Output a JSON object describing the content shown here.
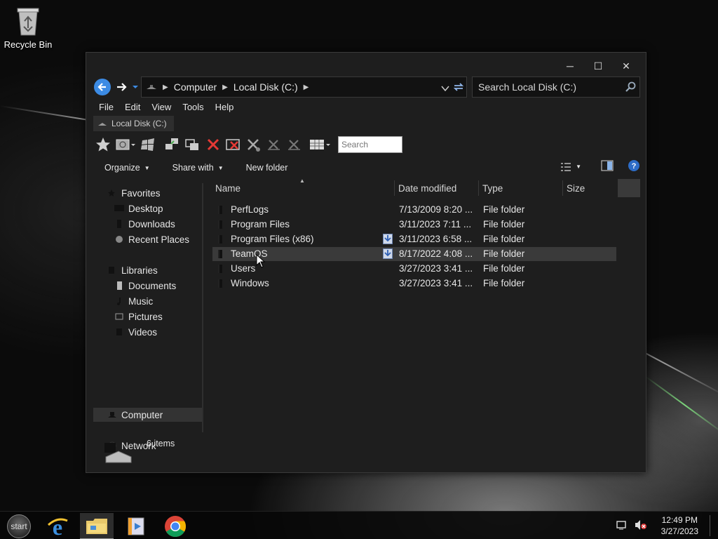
{
  "desktop": {
    "icons": [
      {
        "label": "Recycle Bin",
        "icon": "recycle-bin-icon"
      }
    ]
  },
  "window": {
    "controls": {
      "minimize": "─",
      "maximize": "☐",
      "close": "✕"
    },
    "address": {
      "segments": [
        "Computer",
        "Local Disk (C:)"
      ],
      "search_placeholder": "Search Local Disk (C:)"
    },
    "menu": [
      "File",
      "Edit",
      "View",
      "Tools",
      "Help"
    ],
    "tab_label": "Local Disk (C:)",
    "toolbar_search_placeholder": "Search",
    "commands": {
      "organize": "Organize",
      "share_with": "Share with",
      "new_folder": "New folder"
    },
    "nav_pane": {
      "favorites": {
        "label": "Favorites",
        "items": [
          "Desktop",
          "Downloads",
          "Recent Places"
        ]
      },
      "libraries": {
        "label": "Libraries",
        "items": [
          "Documents",
          "Music",
          "Pictures",
          "Videos"
        ]
      },
      "computer": "Computer",
      "network": "Network"
    },
    "columns": [
      "Name",
      "Date modified",
      "Type",
      "Size"
    ],
    "files": [
      {
        "name": "PerfLogs",
        "date": "7/13/2009 8:20 ...",
        "type": "File folder",
        "badge": false
      },
      {
        "name": "Program Files",
        "date": "3/11/2023 7:11 ...",
        "type": "File folder",
        "badge": false
      },
      {
        "name": "Program Files (x86)",
        "date": "3/11/2023 6:58 ...",
        "type": "File folder",
        "badge": true
      },
      {
        "name": "TeamOS",
        "date": "8/17/2022 4:08 ...",
        "type": "File folder",
        "badge": true,
        "selected": true
      },
      {
        "name": "Users",
        "date": "3/27/2023 3:41 ...",
        "type": "File folder",
        "badge": false
      },
      {
        "name": "Windows",
        "date": "3/27/2023 3:41 ...",
        "type": "File folder",
        "badge": false
      }
    ],
    "status": {
      "item_count": "6 items"
    }
  },
  "taskbar": {
    "start_label": "start",
    "apps": [
      "internet-explorer-icon",
      "file-explorer-icon",
      "media-player-icon",
      "chrome-icon"
    ],
    "clock": {
      "time": "12:49 PM",
      "date": "3/27/2023"
    }
  },
  "colors": {
    "accent": "#3c8be4",
    "window_bg": "#1e1e1e",
    "selection": "#3a3a3a"
  }
}
